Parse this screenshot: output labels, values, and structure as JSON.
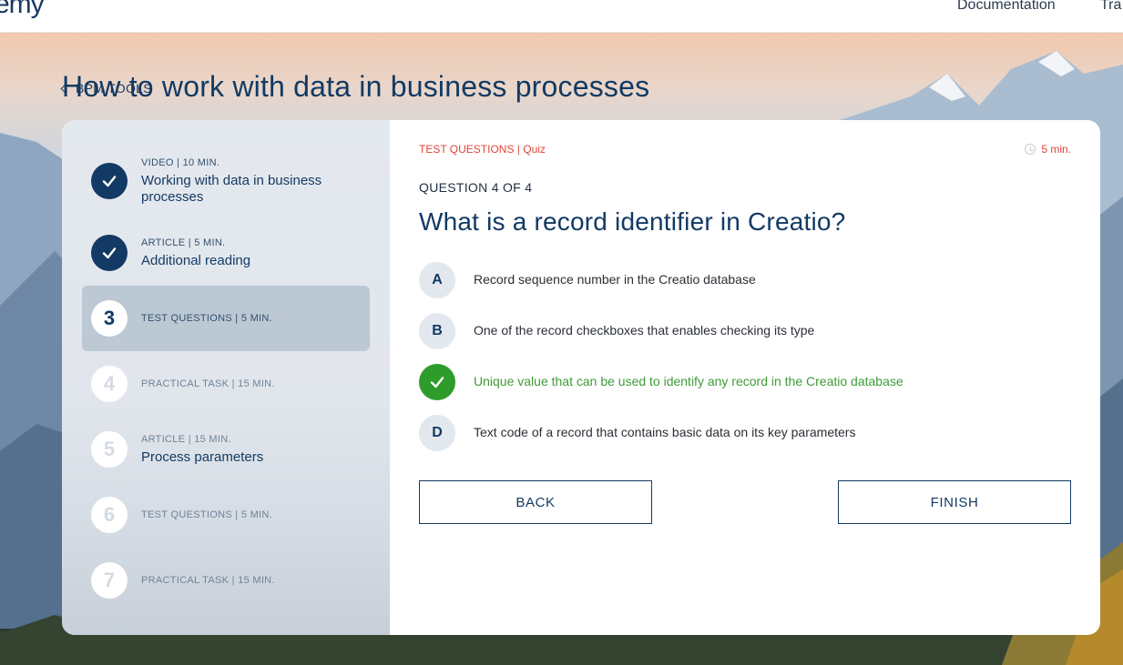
{
  "nav": {
    "logo": "emy",
    "links": [
      "Documentation",
      "Tra"
    ]
  },
  "breadcrumb": "BPM TOOLS",
  "page_title": "How to work with data in business processes",
  "steps": [
    {
      "num": "",
      "meta": "VIDEO | 10 MIN.",
      "name": "Working with data in business processes",
      "state": "done"
    },
    {
      "num": "",
      "meta": "ARTICLE | 5 MIN.",
      "name": "Additional reading",
      "state": "done"
    },
    {
      "num": "3",
      "meta": "TEST QUESTIONS | 5 MIN.",
      "name": "",
      "state": "current"
    },
    {
      "num": "4",
      "meta": "PRACTICAL TASK | 15 MIN.",
      "name": "",
      "state": "todo"
    },
    {
      "num": "5",
      "meta": "ARTICLE | 15 MIN.",
      "name": "Process parameters",
      "state": "todo"
    },
    {
      "num": "6",
      "meta": "TEST QUESTIONS | 5 MIN.",
      "name": "",
      "state": "todo"
    },
    {
      "num": "7",
      "meta": "PRACTICAL TASK | 15 MIN.",
      "name": "",
      "state": "todo"
    }
  ],
  "quiz": {
    "type_label": "TEST QUESTIONS | Quiz",
    "duration": "5 min.",
    "counter": "QUESTION 4 OF 4",
    "question": "What is a record identifier in Creatio?",
    "options": [
      {
        "letter": "A",
        "text": "Record sequence number in the Creatio database",
        "correct": false
      },
      {
        "letter": "B",
        "text": "One of the record checkboxes that enables checking its type",
        "correct": false
      },
      {
        "letter": "C",
        "text": "Unique value that can be used to identify any record in the Creatio database",
        "correct": true
      },
      {
        "letter": "D",
        "text": "Text code of a record that contains basic data on its key parameters",
        "correct": false
      }
    ],
    "back_label": "BACK",
    "finish_label": "FINISH"
  },
  "colors": {
    "brand": "#123a64",
    "accent_red": "#e0453a",
    "correct_green": "#2d9c2a"
  }
}
